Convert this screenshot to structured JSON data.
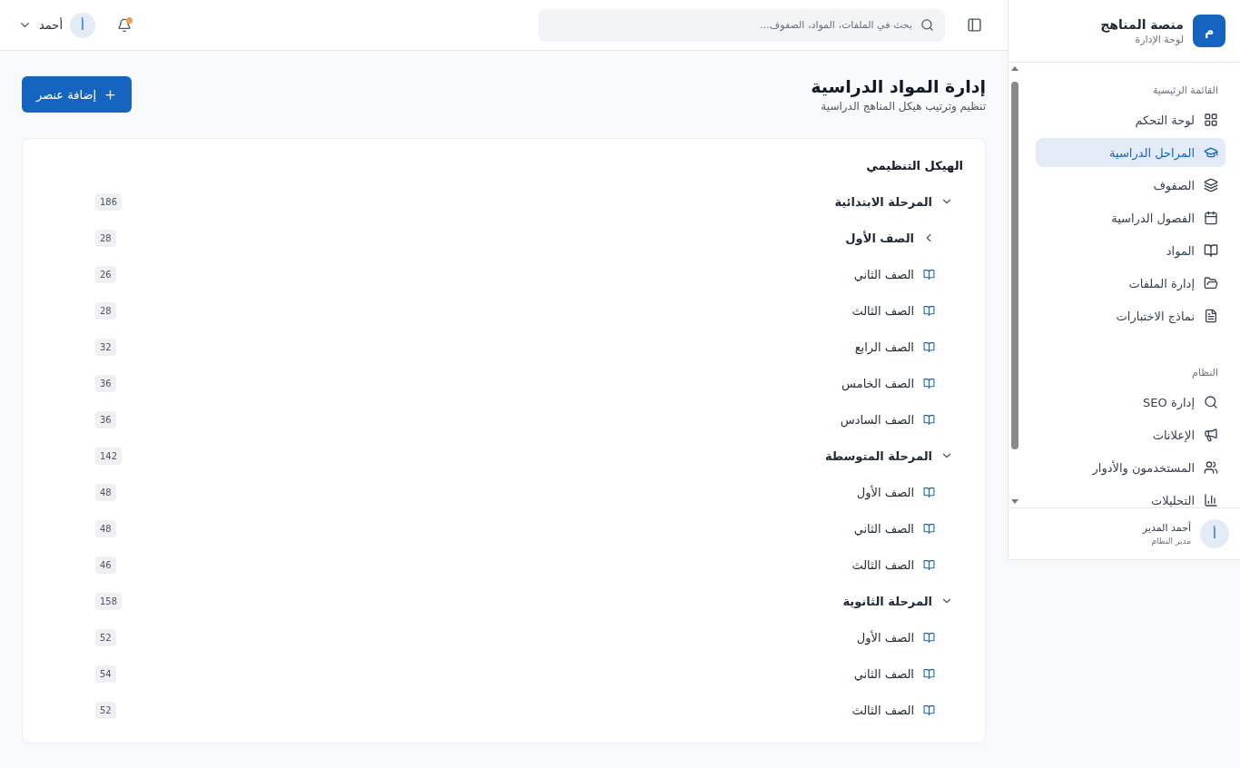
{
  "sidebar": {
    "logo_letter": "م",
    "title": "منصة المناهج",
    "subtitle": "لوحة الإدارة",
    "sections": [
      {
        "heading": "القائمة الرئيسية",
        "items": [
          {
            "label": "لوحة التحكم",
            "selected": false
          },
          {
            "label": "المراحل الدراسية",
            "selected": true
          },
          {
            "label": "الصفوف",
            "selected": false
          },
          {
            "label": "الفصول الدراسية",
            "selected": false
          },
          {
            "label": "المواد",
            "selected": false
          },
          {
            "label": "إدارة الملفات",
            "selected": false
          },
          {
            "label": "نماذج الاختبارات",
            "selected": false
          }
        ]
      },
      {
        "heading": "النظام",
        "items": [
          {
            "label": "إدارة SEO",
            "selected": false
          },
          {
            "label": "الإعلانات",
            "selected": false
          },
          {
            "label": "المستخدمون والأدوار",
            "selected": false
          },
          {
            "label": "التحليلات",
            "selected": false
          }
        ]
      }
    ],
    "user": {
      "avatar_letter": "أ",
      "name": "أحمد المدير",
      "role": "مدير النظام"
    }
  },
  "topbar": {
    "search": {
      "placeholder": "بحث في الملفات، المواد، الصفوف..."
    },
    "notifications": {
      "unread": true
    },
    "user": {
      "avatar_letter": "أ",
      "name": "أحمد"
    }
  },
  "page": {
    "title": "إدارة المواد الدراسية",
    "subtitle": "تنظيم وترتيب هيكل المناهج الدراسية",
    "add_button": "إضافة عنصر"
  },
  "tree": {
    "title": "الهيكل التنظيمي",
    "items": [
      {
        "label": "المرحلة الابتدائية",
        "count": "186",
        "kind": "group",
        "expanded": true,
        "children": [
          {
            "label": "الصف الأول",
            "count": "28",
            "kind": "group",
            "expanded": false
          },
          {
            "label": "الصف الثاني",
            "count": "26",
            "kind": "leaf"
          },
          {
            "label": "الصف الثالث",
            "count": "28",
            "kind": "leaf"
          },
          {
            "label": "الصف الرابع",
            "count": "32",
            "kind": "leaf"
          },
          {
            "label": "الصف الخامس",
            "count": "36",
            "kind": "leaf"
          },
          {
            "label": "الصف السادس",
            "count": "36",
            "kind": "leaf"
          }
        ]
      },
      {
        "label": "المرحلة المتوسطة",
        "count": "142",
        "kind": "group",
        "expanded": true,
        "children": [
          {
            "label": "الصف الأول",
            "count": "48",
            "kind": "leaf"
          },
          {
            "label": "الصف الثاني",
            "count": "48",
            "kind": "leaf"
          },
          {
            "label": "الصف الثالث",
            "count": "46",
            "kind": "leaf"
          }
        ]
      },
      {
        "label": "المرحلة الثانوية",
        "count": "158",
        "kind": "group",
        "expanded": true,
        "children": [
          {
            "label": "الصف الأول",
            "count": "52",
            "kind": "leaf"
          },
          {
            "label": "الصف الثاني",
            "count": "54",
            "kind": "leaf"
          },
          {
            "label": "الصف الثالث",
            "count": "52",
            "kind": "leaf"
          }
        ]
      }
    ]
  }
}
